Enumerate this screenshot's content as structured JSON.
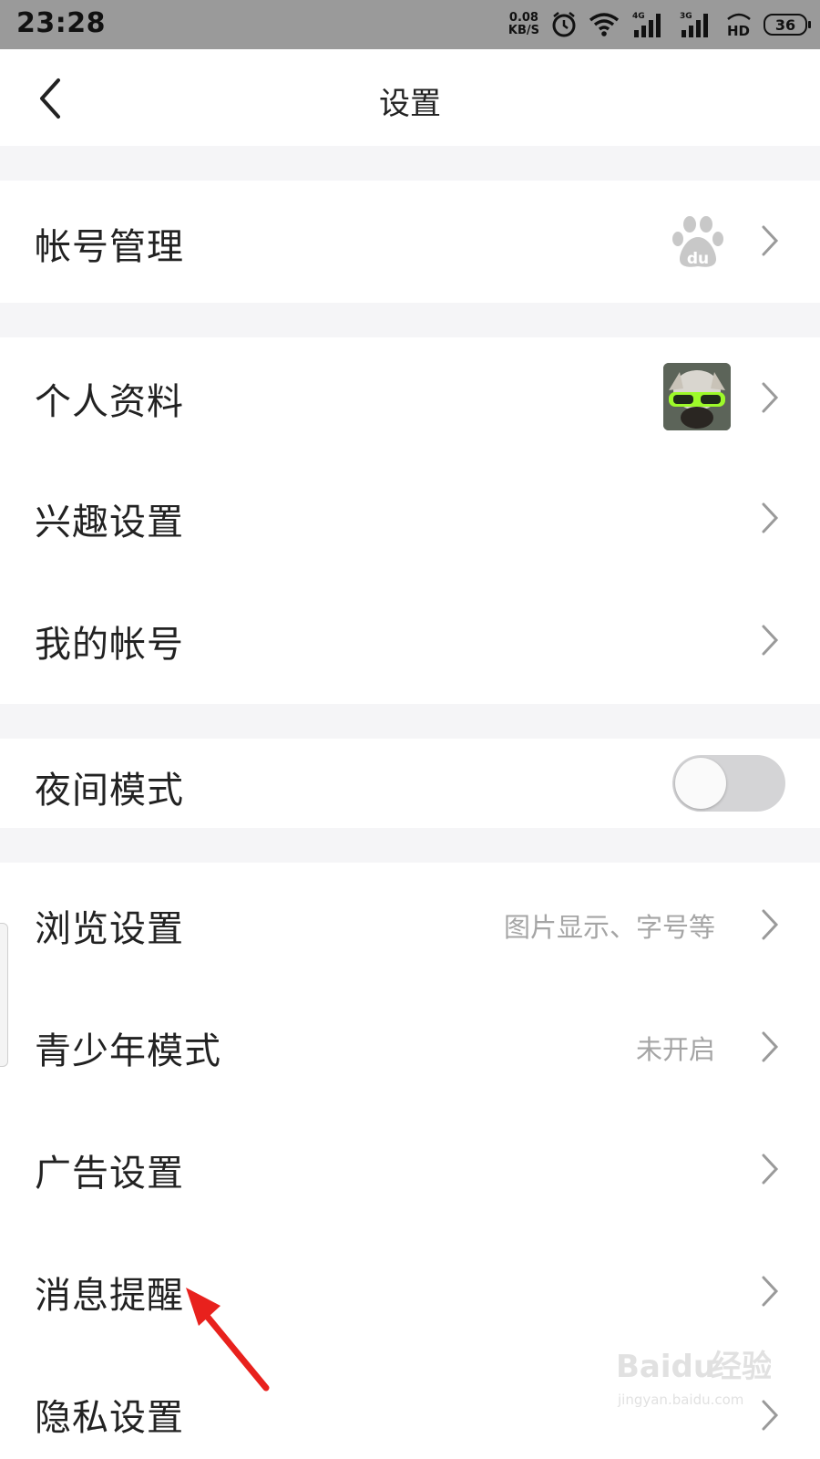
{
  "status_bar": {
    "time": "23:28",
    "net_speed_value": "0.08",
    "net_speed_unit": "KB/S",
    "signal1_type": "4G",
    "signal2_type": "3G",
    "hd_label": "HD",
    "battery": "36"
  },
  "nav": {
    "title": "设置",
    "back_icon": "chevron-left-icon"
  },
  "rows": {
    "account_management": {
      "label": "帐号管理",
      "icon": "baidu-paw-logo"
    },
    "profile": {
      "label": "个人资料"
    },
    "interests": {
      "label": "兴趣设置"
    },
    "my_account": {
      "label": "我的帐号"
    },
    "night_mode": {
      "label": "夜间模式",
      "enabled": false
    },
    "browse": {
      "label": "浏览设置",
      "value": "图片显示、字号等"
    },
    "teen_mode": {
      "label": "青少年模式",
      "value": "未开启"
    },
    "ads": {
      "label": "广告设置"
    },
    "notifications": {
      "label": "消息提醒"
    },
    "privacy": {
      "label": "隐私设置"
    }
  },
  "annotation": {
    "arrow_color": "#e8211d"
  },
  "watermark": {
    "brand": "Baidu",
    "product": "经验",
    "site": "jingyan.baidu.com"
  },
  "colors": {
    "separator": "#f5f5f7",
    "toggle_off": "#d4d4d6",
    "secondary_text": "#a5a5a5",
    "statusbar": "#9a9a9a"
  }
}
